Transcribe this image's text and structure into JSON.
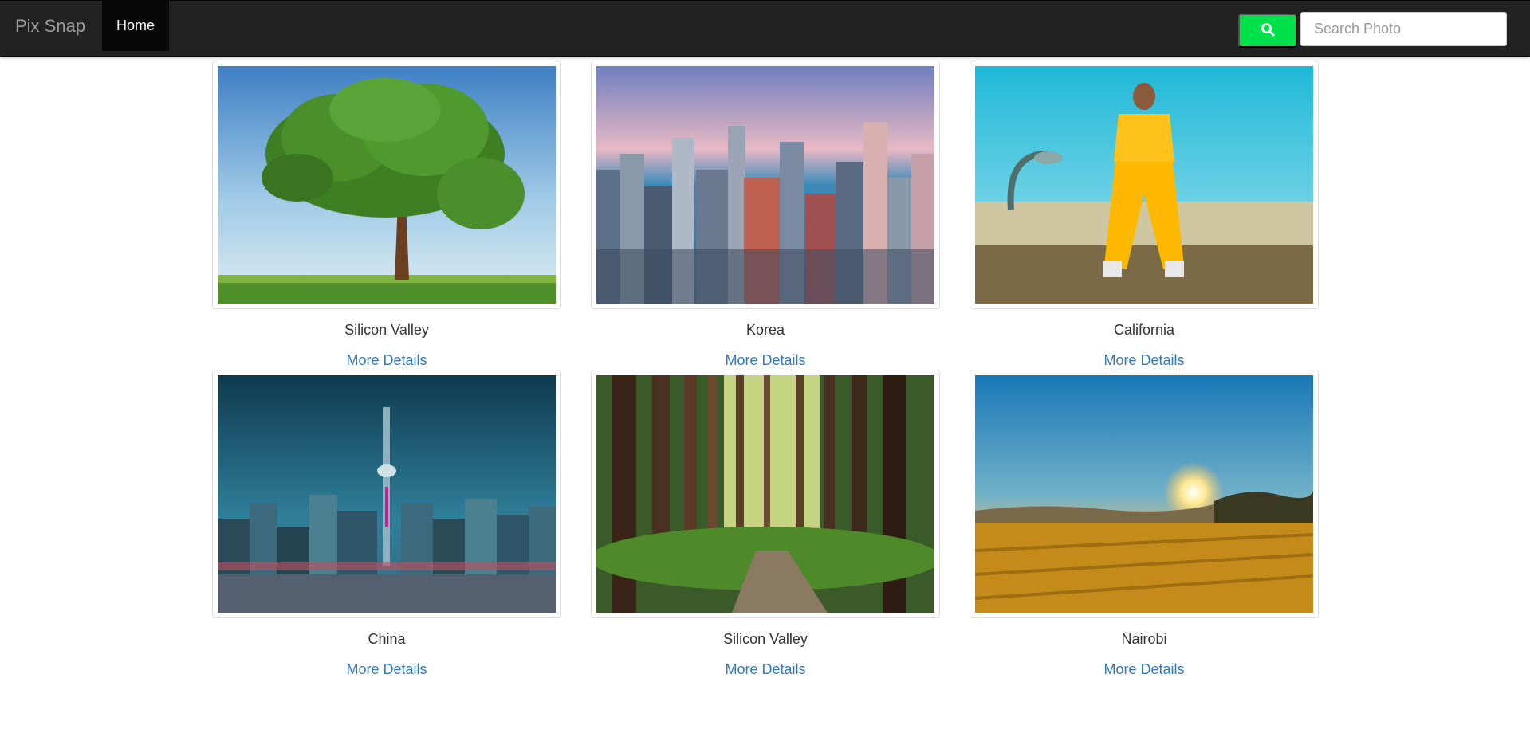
{
  "navbar": {
    "brand": "Pix Snap",
    "home_label": "Home",
    "search_placeholder": "Search Photo",
    "search_icon": "search-icon",
    "accent_color": "#00e04a"
  },
  "gallery": [
    {
      "caption": "Silicon Valley",
      "link_label": "More Details",
      "image": "tree-photo"
    },
    {
      "caption": "Korea",
      "link_label": "More Details",
      "image": "city-skyline-photo"
    },
    {
      "caption": "California",
      "link_label": "More Details",
      "image": "yellow-outfit-photo"
    },
    {
      "caption": "China",
      "link_label": "More Details",
      "image": "tower-skyline-photo"
    },
    {
      "caption": "Silicon Valley",
      "link_label": "More Details",
      "image": "forest-path-photo"
    },
    {
      "caption": "Nairobi",
      "link_label": "More Details",
      "image": "sunset-field-photo"
    }
  ]
}
